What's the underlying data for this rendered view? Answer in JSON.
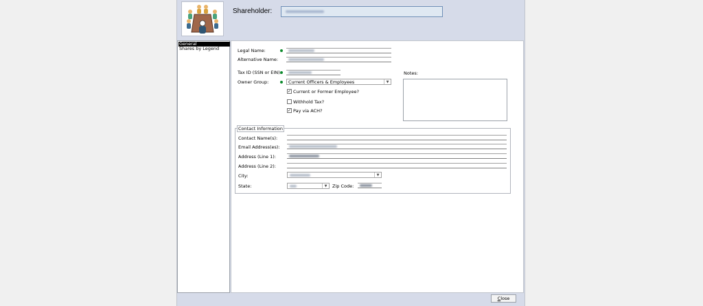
{
  "header": {
    "label": "Shareholder:",
    "value_obscured": true
  },
  "nav": {
    "items": [
      {
        "label": "General",
        "active": true
      },
      {
        "label": "Shares by Legend",
        "active": false
      }
    ]
  },
  "general": {
    "legal_name_label": "Legal Name:",
    "alternative_name_label": "Alternative Name:",
    "tax_id_label": "Tax ID (SSN or EIN):",
    "owner_group_label": "Owner Group:",
    "owner_group_value": "Current Officers & Employees",
    "current_former_employee_label": "Current or Former Employee?",
    "current_former_employee_checked": true,
    "withhold_tax_label": "Withhold Tax?",
    "withhold_tax_checked": false,
    "pay_via_ach_label": "Pay via ACH?",
    "pay_via_ach_checked": true,
    "notes_label": "Notes:",
    "required_color": "#0b8a2c"
  },
  "contact": {
    "group_title": "Contact Information",
    "contact_names_label": "Contact Name(s):",
    "email_label": "Email Address(es):",
    "address1_label": "Address (Line 1):",
    "address2_label": "Address (Line 2):",
    "city_label": "City:",
    "state_label": "State:",
    "zip_label": "Zip Code:"
  },
  "footer": {
    "close_label": "lose",
    "close_accel": "C"
  },
  "icons": {
    "logo": "boardroom-meeting-icon",
    "dropdown": "chevron-down-icon",
    "check": "checkmark-icon"
  }
}
